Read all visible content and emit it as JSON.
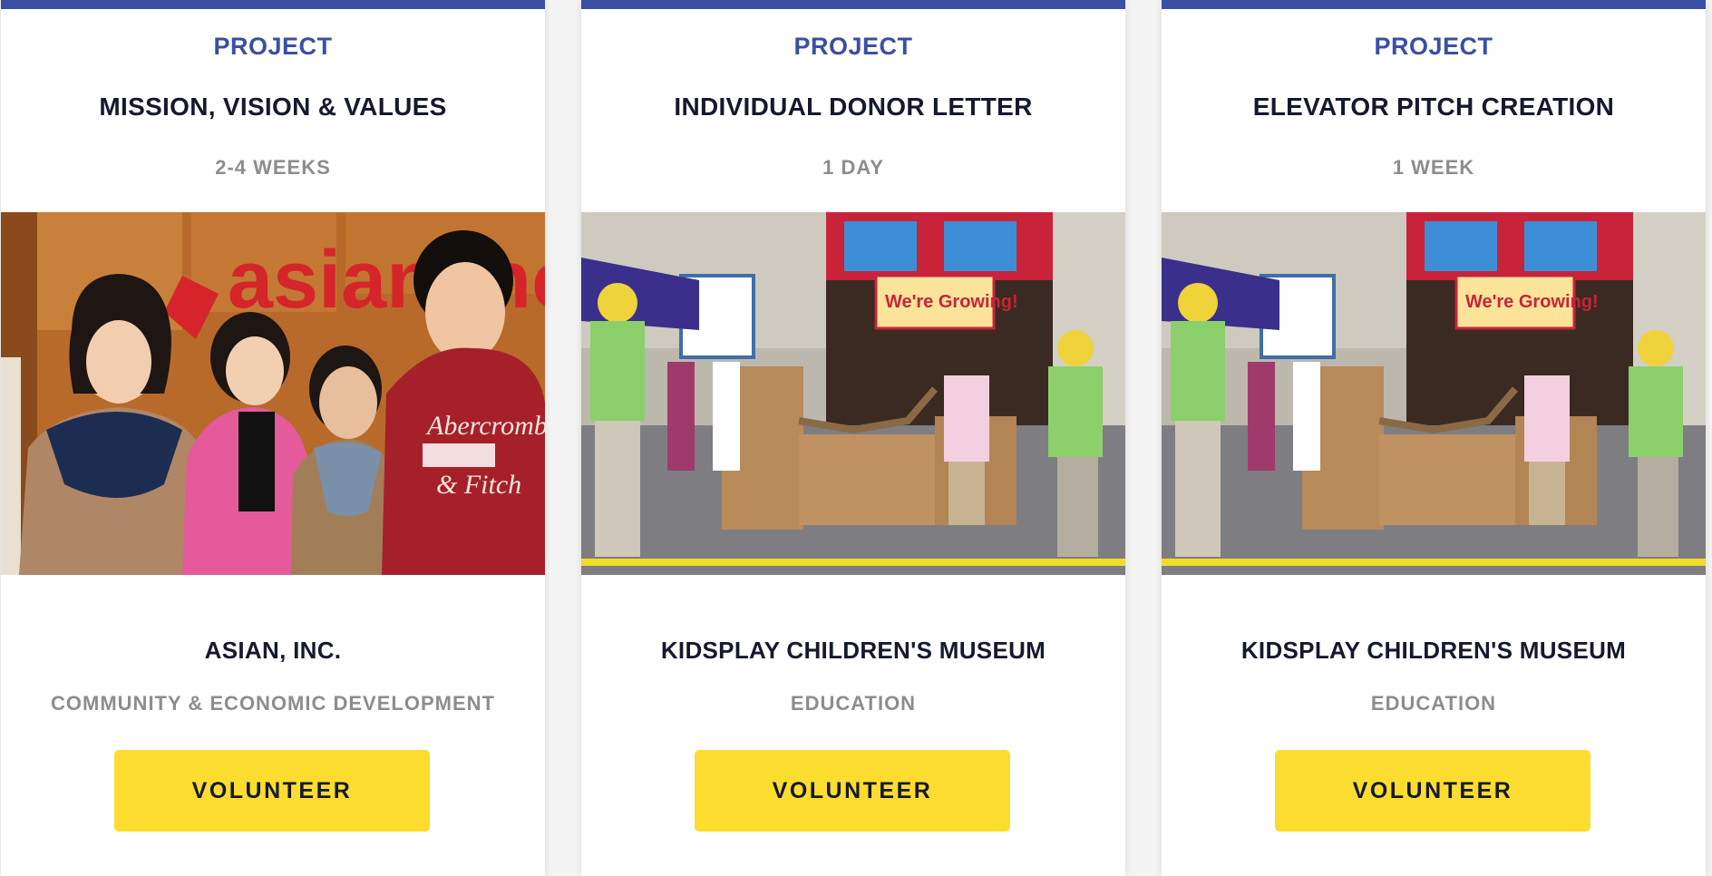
{
  "cards": [
    {
      "type_label": "PROJECT",
      "title": "MISSION, VISION & VALUES",
      "duration": "2-4 WEEKS",
      "organization": "ASIAN, INC.",
      "category": "COMMUNITY & ECONOMIC DEVELOPMENT",
      "button_label": "VOLUNTEER",
      "photo_sign_text": "asian inc"
    },
    {
      "type_label": "PROJECT",
      "title": "INDIVIDUAL DONOR LETTER",
      "duration": "1 DAY",
      "organization": "KIDSPLAY CHILDREN'S MUSEUM",
      "category": "EDUCATION",
      "button_label": "VOLUNTEER",
      "photo_sign_text": "We're Growing!"
    },
    {
      "type_label": "PROJECT",
      "title": "ELEVATOR PITCH CREATION",
      "duration": "1 WEEK",
      "organization": "KIDSPLAY CHILDREN'S MUSEUM",
      "category": "EDUCATION",
      "button_label": "VOLUNTEER",
      "photo_sign_text": "We're Growing!"
    }
  ],
  "colors": {
    "accent_blue": "#3a4fa3",
    "title_dark": "#141a2e",
    "muted_gray": "#8d8d8d",
    "button_yellow": "#fddc30"
  }
}
